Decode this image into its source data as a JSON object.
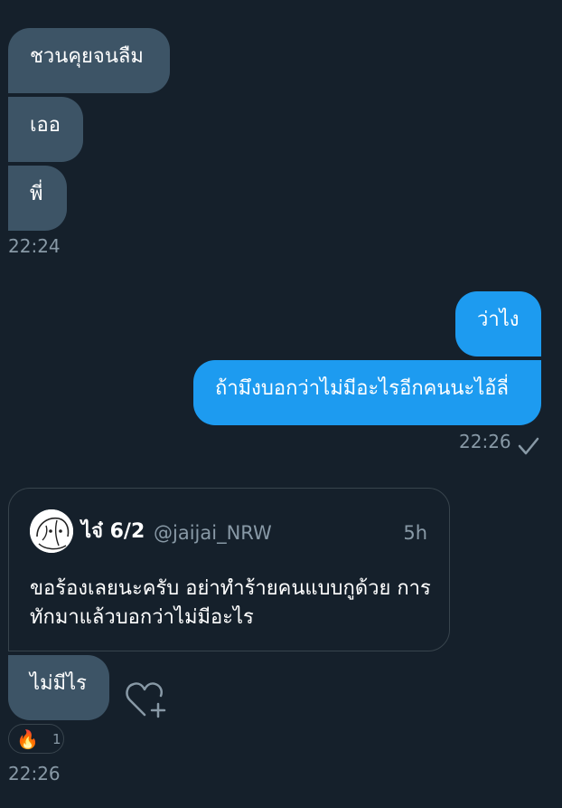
{
  "messages": {
    "received_1": "ชวนคุยจนลืม",
    "received_2": "เออ",
    "received_3": "พี่",
    "time_1": "22:24",
    "sent_1": "ว่าไง",
    "sent_2": "ถ้ามึงบอกว่าไม่มีอะไรอีกคนนะไอ้ลี่",
    "time_2": "22:26",
    "received_4": "ไม่มีไร",
    "time_3": "22:26"
  },
  "quoted_tweet": {
    "name": "ไจ๋ 6/2",
    "handle": "@jaijai_NRW",
    "time": "5h",
    "text": "ขอร้องเลยนะครับ อย่าทำร้ายคนแบบกูด้วย การทักมาแล้วบอกว่าไม่มีอะไร"
  },
  "reaction": {
    "emoji": "🔥",
    "count": "1"
  },
  "icons": {
    "read_receipt": "checkmark-icon",
    "react": "heart-plus-icon",
    "avatar": "profile-avatar"
  },
  "colors": {
    "background": "#15202b",
    "incoming_bubble": "#3d5466",
    "outgoing_bubble": "#1d9bf0",
    "meta_text": "#8899a6"
  }
}
